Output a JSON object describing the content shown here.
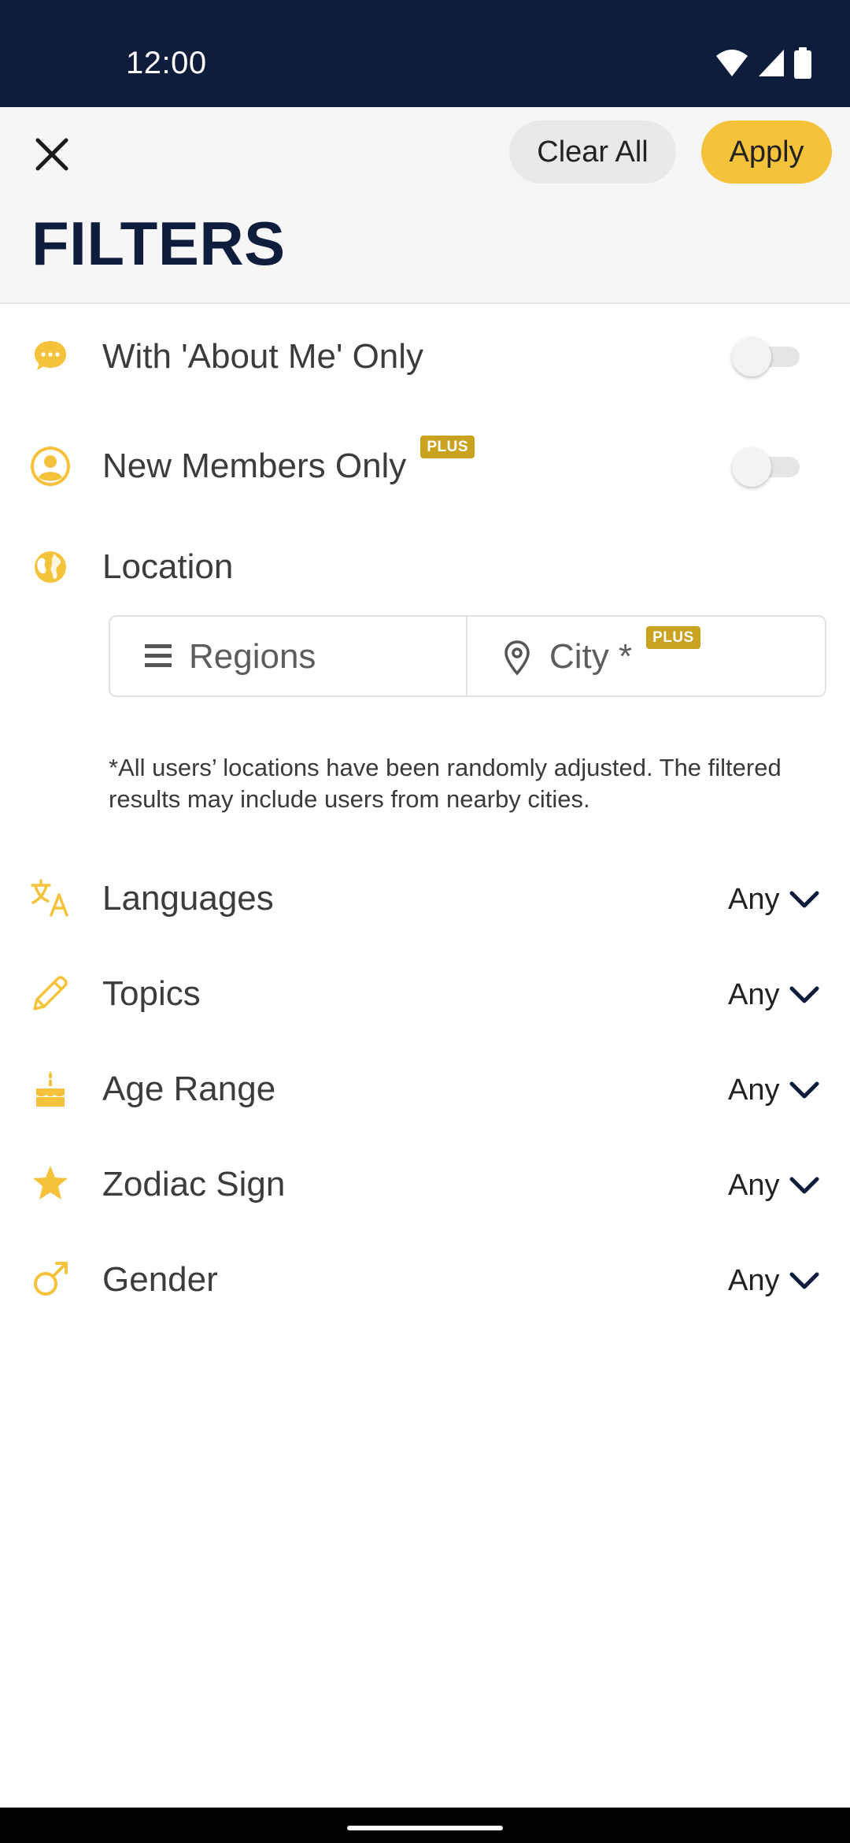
{
  "status_bar": {
    "time": "12:00",
    "icons": [
      "wifi-icon",
      "cell-signal-icon",
      "battery-icon"
    ]
  },
  "header": {
    "close_icon": "close-icon",
    "clear_label": "Clear All",
    "apply_label": "Apply",
    "title": "FILTERS"
  },
  "toggles": [
    {
      "label": "With 'About Me' Only",
      "icon": "chat-bubble-icon",
      "on": false,
      "plus": false
    },
    {
      "label": "New Members Only",
      "icon": "person-icon",
      "on": false,
      "plus": true
    }
  ],
  "plus_badge": "PLUS",
  "location": {
    "label": "Location",
    "icon": "globe-icon",
    "regions_label": "Regions",
    "city_label": "City *",
    "note": "*All users’ locations have been randomly adjusted. The filtered results may include users from nearby cities."
  },
  "dropdowns": [
    {
      "label": "Languages",
      "value": "Any",
      "icon": "translate-icon"
    },
    {
      "label": "Topics",
      "value": "Any",
      "icon": "pencil-icon"
    },
    {
      "label": "Age Range",
      "value": "Any",
      "icon": "cake-icon"
    },
    {
      "label": "Zodiac Sign",
      "value": "Any",
      "icon": "star-icon"
    },
    {
      "label": "Gender",
      "value": "Any",
      "icon": "male-icon"
    }
  ],
  "colors": {
    "accent": "#f5c33b",
    "navy": "#0f1d3c",
    "plus_badge": "#c9a21f"
  }
}
